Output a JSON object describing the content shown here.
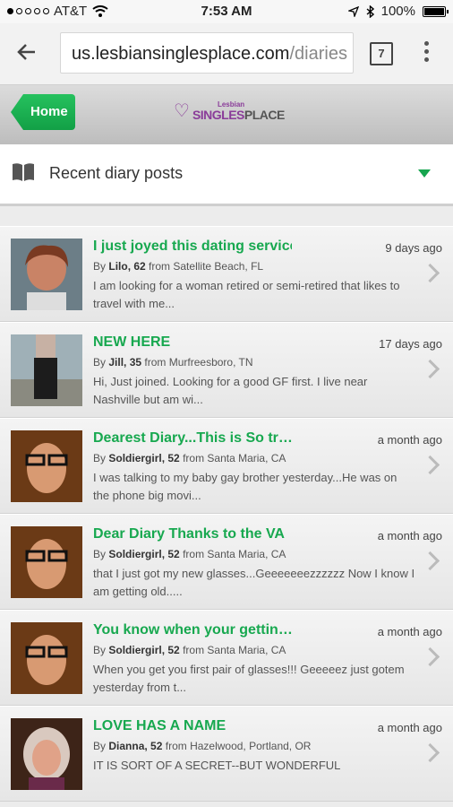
{
  "status": {
    "carrier": "AT&T",
    "time": "7:53 AM",
    "battery": "100%"
  },
  "browser": {
    "url_host": "us.lesbiansinglesplace.com",
    "url_path": "/diaries",
    "tab_count": "7"
  },
  "header": {
    "home_label": "Home",
    "logo_small": "Lesbian",
    "logo_main_a": "SINGLES",
    "logo_main_b": "PLACE"
  },
  "section": {
    "title": "Recent diary posts"
  },
  "posts": [
    {
      "title": "I just joyed this dating service",
      "date": "9 days ago",
      "by": "By",
      "who": "Lilo, 62",
      "from": "from Satellite Beach, FL",
      "body": "I am looking for a woman retired or semi-retired that likes to travel with me..."
    },
    {
      "title": "NEW HERE",
      "date": "17 days ago",
      "by": "By",
      "who": "Jill, 35",
      "from": "from Murfreesboro, TN",
      "body": "Hi, Just joined. Looking for a good GF first. I live near Nashville but am wi..."
    },
    {
      "title": "Dearest Diary...This is So tr…",
      "date": "a month ago",
      "by": "By",
      "who": "Soldiergirl, 52",
      "from": "from Santa Maria, CA",
      "body": "I was talking to my baby gay brother yesterday...He was on the phone big movi..."
    },
    {
      "title": "Dear Diary Thanks to the VA",
      "date": "a month ago",
      "by": "By",
      "who": "Soldiergirl, 52",
      "from": "from Santa Maria, CA",
      "body": "that I just got my new glasses...Geeeeeeezzzzzz Now I know I am getting old....."
    },
    {
      "title": "You know when your gettin…",
      "date": "a month ago",
      "by": "By",
      "who": "Soldiergirl, 52",
      "from": "from Santa Maria, CA",
      "body": "When you get you first pair of glasses!!! Geeeeez just gotem yesterday from t..."
    },
    {
      "title": "LOVE HAS A NAME",
      "date": "a month ago",
      "by": "By",
      "who": "Dianna, 52",
      "from": "from Hazelwood, Portland, OR",
      "body": "IT IS SORT OF A SECRET--BUT WONDERFUL"
    }
  ]
}
